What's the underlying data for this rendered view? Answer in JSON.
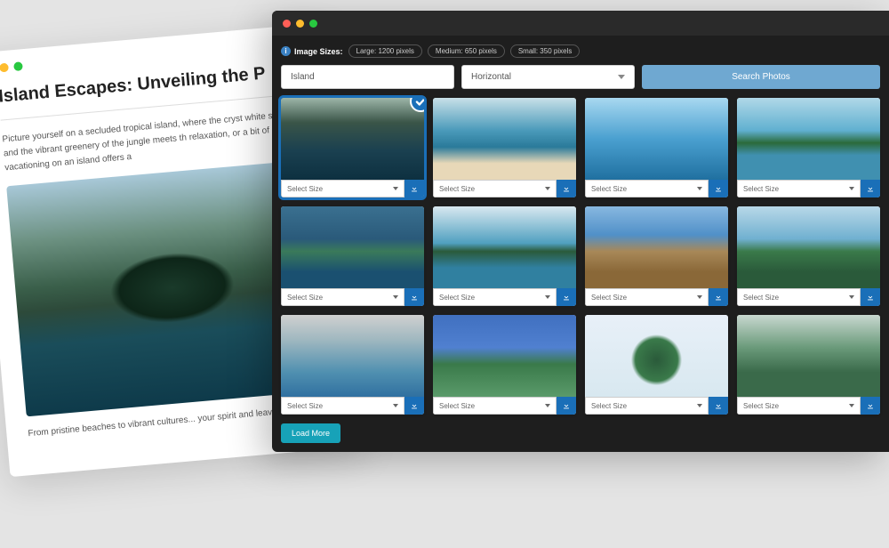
{
  "document": {
    "title": "Island Escapes: Unveiling the P",
    "paragraph1": "Picture yourself on a secluded tropical island, where the cryst white shores, and the vibrant greenery of the jungle meets th relaxation, or a bit of both, vacationing on an island offers a",
    "paragraph2": "From pristine beaches to vibrant cultures... your spirit and leave you with..."
  },
  "app": {
    "sizes_label": "Image Sizes:",
    "sizes": [
      {
        "label": "Large: 1200 pixels"
      },
      {
        "label": "Medium: 650 pixels"
      },
      {
        "label": "Small: 350 pixels"
      }
    ],
    "search_value": "Island",
    "orientation_value": "Horizontal",
    "search_button": "Search Photos",
    "select_size_label": "Select Size",
    "load_more": "Load More",
    "thumbs": [
      "t0",
      "t1",
      "t2",
      "t3",
      "t4",
      "t5",
      "t6",
      "t7",
      "t8",
      "t9",
      "t10",
      "t11"
    ]
  }
}
